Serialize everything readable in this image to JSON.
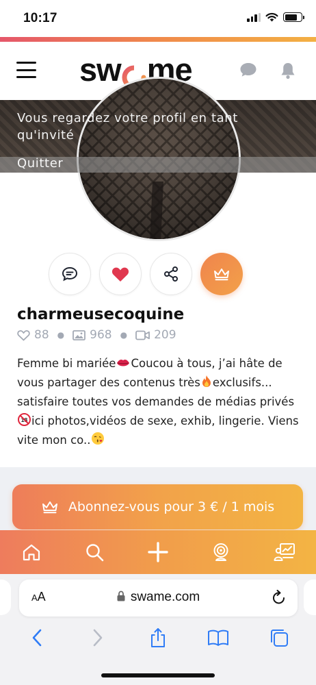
{
  "status_bar": {
    "time": "10:17"
  },
  "header": {
    "logo_text_left": "sw",
    "logo_text_right": "me",
    "icons": [
      "menu-icon",
      "chat-icon",
      "bell-icon"
    ]
  },
  "guest_banner": {
    "notice": "Vous regardez votre profil en tant qu'invité",
    "quit_label": "Quitter"
  },
  "actions": [
    "message-icon",
    "heart-icon",
    "share-icon",
    "crown-icon"
  ],
  "profile": {
    "username": "charmeusecoquine",
    "likes": "88",
    "photos": "968",
    "videos": "209",
    "bio_parts": [
      "Femme bi mariée",
      "Coucou à tous, j’ai hâte de vous partager des contenus très",
      "exclusifs... satisfaire toutes vos demandes de médias privés ",
      "ici photos,vidéos de sexe, exhib, lingerie. Viens vite mon co..",
      ""
    ],
    "bio_emojis": [
      "lips-emoji",
      "fire-emoji",
      "no-under-18-emoji",
      "kiss-face-emoji"
    ]
  },
  "subscribe": {
    "label": "Abonnez-vous pour 3 € / 1 mois"
  },
  "bottom_nav": [
    "home-icon",
    "search-icon",
    "plus-icon",
    "webcam-icon",
    "dashboard-icon"
  ],
  "browser": {
    "aa_small": "A",
    "aa_large": "A",
    "url": "swame.com",
    "toolbar": [
      "back-icon",
      "forward-icon",
      "share-icon",
      "bookmarks-icon",
      "tabs-icon"
    ]
  },
  "colors": {
    "brand_orange": "#f08a4b",
    "brand_yellow": "#f3b043",
    "brand_pink": "#e5576a",
    "heart_red": "#e0384f",
    "ios_blue": "#2f7cf6",
    "muted_grey": "#a3a9b4"
  }
}
